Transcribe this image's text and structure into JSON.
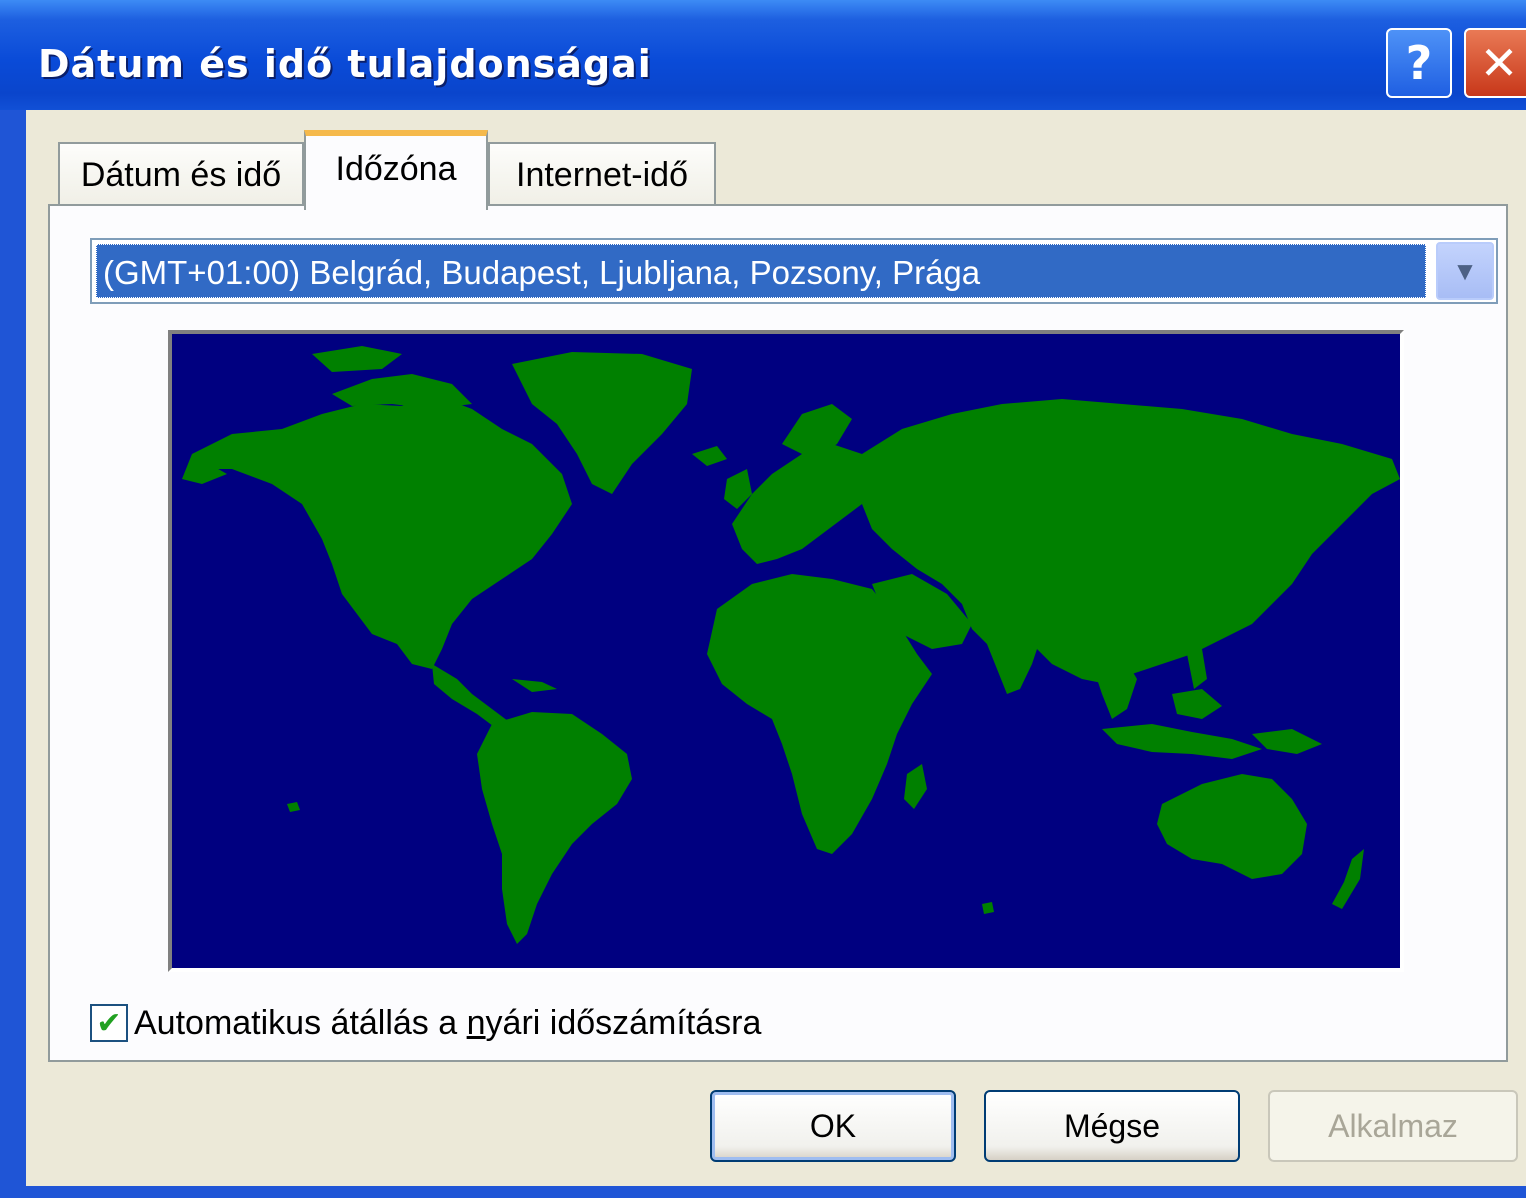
{
  "window": {
    "title": "Dátum és idő tulajdonságai",
    "help_label": "?",
    "close_label": "✕"
  },
  "tabs": [
    {
      "label": "Dátum és idő",
      "selected": false
    },
    {
      "label": "Időzóna",
      "selected": true
    },
    {
      "label": "Internet-idő",
      "selected": false
    }
  ],
  "timezone": {
    "selected": "(GMT+01:00) Belgrád, Budapest, Ljubljana, Pozsony, Prága",
    "dropdown_icon": "chevron-down-icon"
  },
  "map": {
    "ocean_color": "#000080",
    "land_color": "#008000"
  },
  "dst_checkbox": {
    "checked": true,
    "label_before": "Automatikus átállás a ",
    "label_mnemonic": "n",
    "label_after": "yári időszámításra"
  },
  "buttons": {
    "ok": "OK",
    "cancel": "Mégse",
    "apply": "Alkalmaz"
  }
}
